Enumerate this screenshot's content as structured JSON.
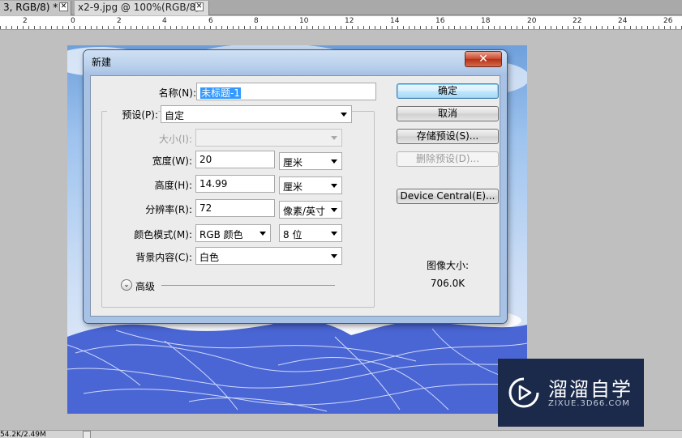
{
  "tabs": [
    {
      "label": "3, RGB/8) *",
      "active": false
    },
    {
      "label": "x2-9.jpg @ 100%(RGB/8)",
      "active": true
    }
  ],
  "tab_close_glyph": "✕",
  "ruler": {
    "labels": [
      "2",
      "0",
      "2",
      "4",
      "6",
      "8",
      "10",
      "12",
      "14",
      "16",
      "18",
      "20",
      "22",
      "24",
      "26"
    ]
  },
  "dialog": {
    "title": "新建",
    "close_glyph": "✕",
    "name_label": "名称(N):",
    "name_value": "未标题-1",
    "preset_label": "预设(P):",
    "preset_value": "自定",
    "size_label": "大小(I):",
    "size_value": "",
    "width_label": "宽度(W):",
    "width_value": "20",
    "width_unit": "厘米",
    "height_label": "高度(H):",
    "height_value": "14.99",
    "height_unit": "厘米",
    "resolution_label": "分辨率(R):",
    "resolution_value": "72",
    "resolution_unit": "像素/英寸",
    "color_mode_label": "颜色模式(M):",
    "color_mode_value": "RGB 颜色",
    "bit_depth": "8 位",
    "background_label": "背景内容(C):",
    "background_value": "白色",
    "advanced_label": "高级",
    "advanced_glyph": "⌄",
    "buttons": {
      "ok": "确定",
      "cancel": "取消",
      "save_preset": "存储预设(S)...",
      "delete_preset": "删除预设(D)...",
      "device_central": "Device Central(E)..."
    },
    "image_size_label": "图像大小:",
    "image_size_value": "706.0K"
  },
  "statusbar": {
    "doc_size": "54.2K/2.49M"
  },
  "watermark": {
    "brand": "溜溜自学",
    "domain": "ZIXUE.3D66.COM"
  },
  "colors": {
    "canvas_blue": "#4a66d4",
    "sky_blue": "#6fa0dc",
    "dialog_frame": "#a7c2e4",
    "default_button": "#a7d9f5"
  }
}
